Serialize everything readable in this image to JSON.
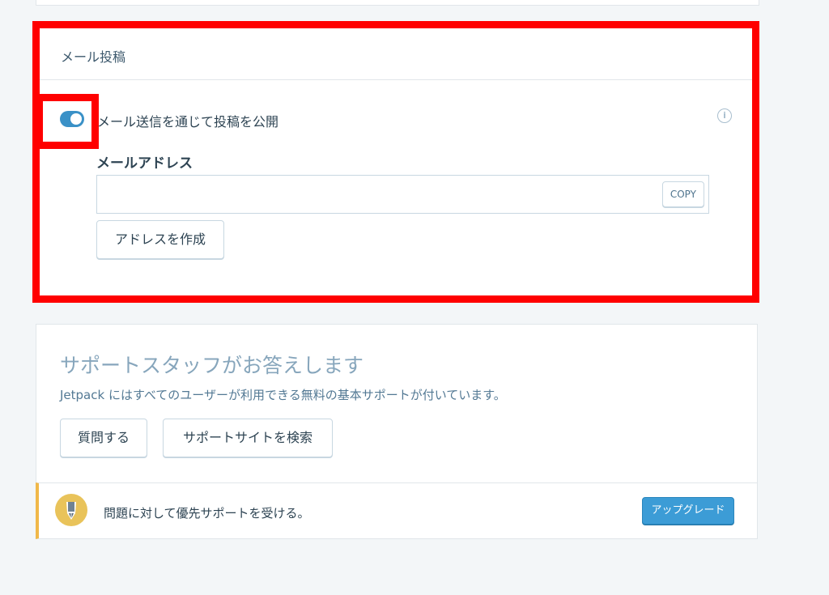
{
  "email_post": {
    "header": "メール投稿",
    "toggle_label": "メール送信を通じて投稿を公開",
    "toggle_on": true,
    "info_icon": "info-icon",
    "address_label": "メールアドレス",
    "address_value": "",
    "copy_label": "COPY",
    "create_address_label": "アドレスを作成",
    "highlight_color": "#ff0000",
    "toggle_color": "#3a91c7"
  },
  "support": {
    "title": "サポートスタッフがお答えします",
    "description": "Jetpack にはすべてのユーザーが利用できる無料の基本サポートが付いています。",
    "ask_label": "質問する",
    "search_label": "サポートサイトを検索"
  },
  "upgrade": {
    "icon": "fountain-pen-icon",
    "text": "問題に対して優先サポートを受ける。",
    "button_label": "アップグレード",
    "accent_color": "#f0b849",
    "button_color": "#3c9cd6"
  }
}
